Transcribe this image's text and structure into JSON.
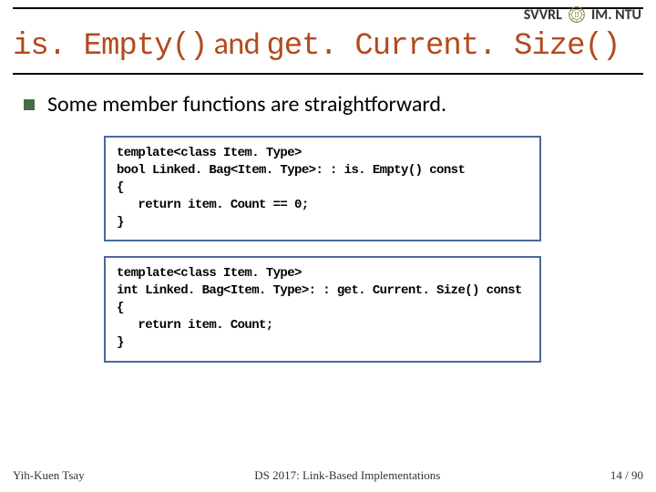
{
  "header": {
    "left": "SVVRL",
    "right": "IM. NTU"
  },
  "title": {
    "mono1": "is. Empty()",
    "plain": " and ",
    "mono2": "get. Current. Size()"
  },
  "bullet": {
    "text": "Some member functions are straightforward."
  },
  "code1": "template<class Item. Type>\nbool Linked. Bag<Item. Type>: : is. Empty() const\n{\n   return item. Count == 0;\n}",
  "code2": "template<class Item. Type>\nint Linked. Bag<Item. Type>: : get. Current. Size() const\n{\n   return item. Count;\n}",
  "footer": {
    "author": "Yih-Kuen Tsay",
    "course": "DS 2017: Link-Based Implementations",
    "pageinfo": "14 / 90"
  }
}
